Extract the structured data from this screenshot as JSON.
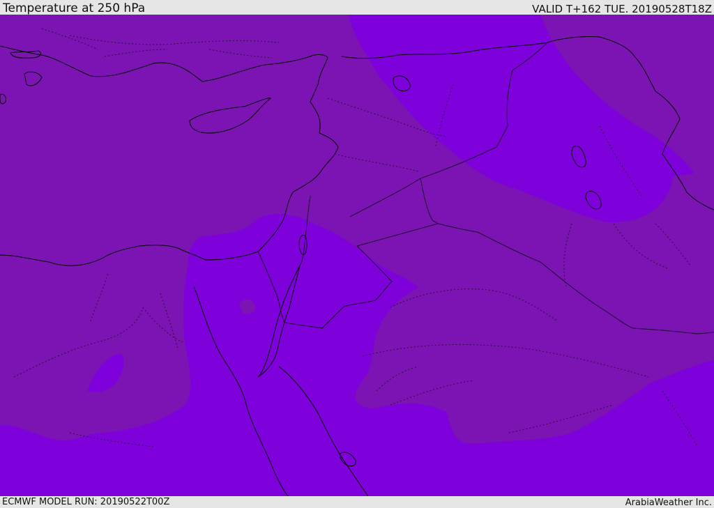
{
  "header": {
    "title": "Temperature at 250 hPa",
    "valid_time": "VALID T+162 TUE. 20190528T18Z"
  },
  "footer": {
    "model_run": "ECMWF MODEL RUN: 20190522T00Z",
    "credit": "ArabiaWeather Inc."
  },
  "colors": {
    "cold_zone": "#7b14b2",
    "warmer_zone": "#7e00da",
    "coastline": "#000000",
    "boundary": "#1a0a2a"
  }
}
